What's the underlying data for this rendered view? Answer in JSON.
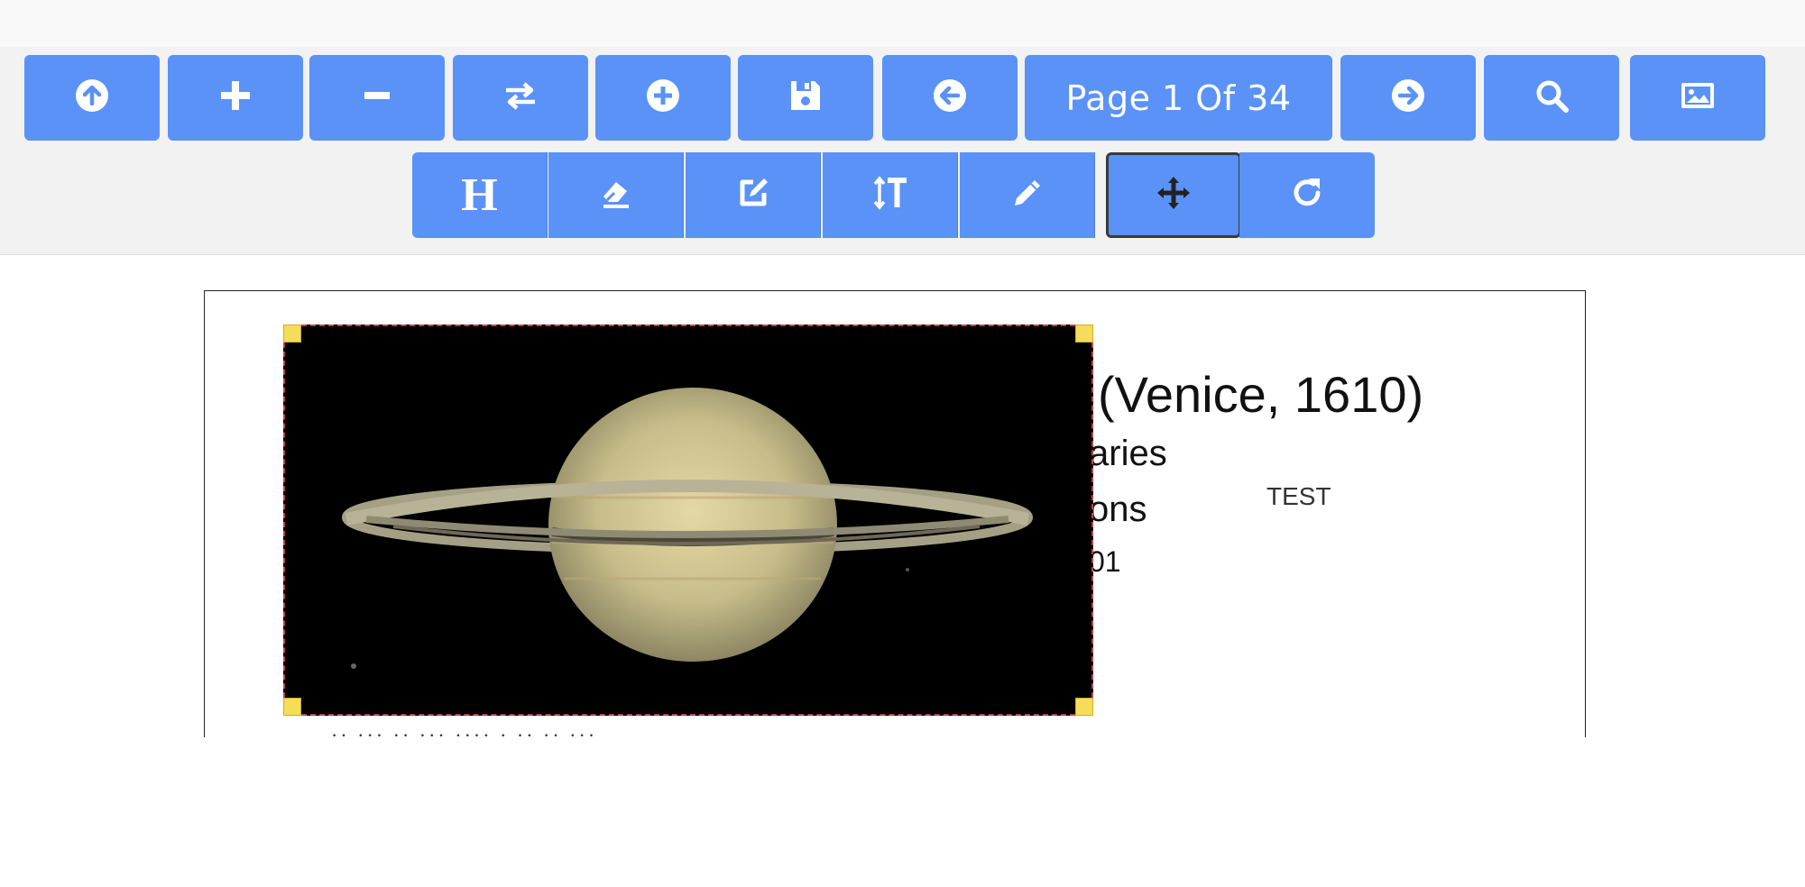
{
  "toolbar": {
    "colors": {
      "button_bg": "#5a92f8",
      "toolbar_bg": "#f2f2f2",
      "active_border": "#3a3a3a"
    },
    "row1": [
      {
        "id": "upload",
        "icon": "arrow-up-circle-icon"
      },
      {
        "id": "zoom-in",
        "icon": "plus-icon"
      },
      {
        "id": "zoom-out",
        "icon": "minus-icon"
      },
      {
        "id": "swap",
        "icon": "swap-arrows-icon"
      },
      {
        "id": "add",
        "icon": "plus-circle-icon"
      },
      {
        "id": "save",
        "icon": "floppy-disk-icon"
      },
      {
        "id": "prev-page",
        "icon": "arrow-left-circle-icon"
      },
      {
        "id": "next-page",
        "icon": "arrow-right-circle-icon"
      },
      {
        "id": "search",
        "icon": "search-icon"
      },
      {
        "id": "image",
        "icon": "image-icon"
      }
    ],
    "page_indicator": "Page 1 Of 34",
    "row2": [
      {
        "id": "heading",
        "label": "H",
        "icon": "heading-icon"
      },
      {
        "id": "eraser",
        "icon": "eraser-icon"
      },
      {
        "id": "edit",
        "icon": "edit-box-icon"
      },
      {
        "id": "text-height",
        "icon": "text-height-icon"
      },
      {
        "id": "pencil",
        "icon": "pencil-icon"
      },
      {
        "id": "move",
        "icon": "move-arrows-icon",
        "active": true
      },
      {
        "id": "redo",
        "icon": "redo-icon"
      }
    ]
  },
  "document": {
    "lines": {
      "title_fragment": "(Venice, 1610)",
      "line2_fragment": "aries",
      "line3_fragment": "ons",
      "line4_fragment": "01",
      "annotation": "TEST"
    },
    "image": {
      "subject": "saturn",
      "selected": true
    }
  }
}
